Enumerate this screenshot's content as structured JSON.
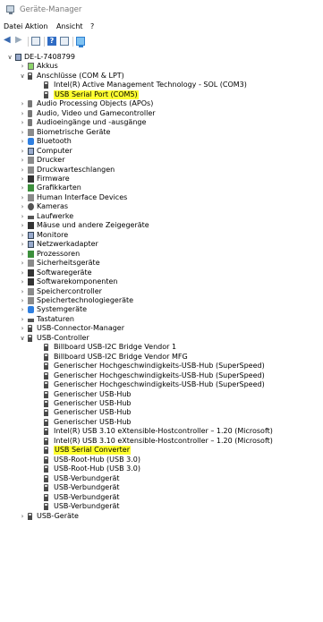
{
  "window": {
    "title": "Geräte-Manager"
  },
  "menu": [
    "Datei",
    "Aktion",
    "Ansicht",
    "?"
  ],
  "tree": [
    {
      "label": "DE-L-7408799",
      "level": 0,
      "exp": "v",
      "icon": "computer-icon",
      "cls": "i-pc"
    },
    {
      "label": "Akkus",
      "level": 1,
      "exp": ">",
      "icon": "battery-icon",
      "cls": "i-bat"
    },
    {
      "label": "Anschlüsse (COM & LPT)",
      "level": 1,
      "exp": "v",
      "icon": "port-icon",
      "cls": "i-usb"
    },
    {
      "label": "Intel(R) Active Management Technology - SOL (COM3)",
      "level": 2,
      "exp": "",
      "icon": "port-icon",
      "cls": "i-usb"
    },
    {
      "label": "USB Serial Port (COM5)",
      "level": 2,
      "exp": "",
      "icon": "port-icon",
      "cls": "i-usb",
      "hl": true
    },
    {
      "label": "Audio Processing Objects (APOs)",
      "level": 1,
      "exp": ">",
      "icon": "speaker-icon",
      "cls": "i-spk"
    },
    {
      "label": "Audio, Video und Gamecontroller",
      "level": 1,
      "exp": ">",
      "icon": "speaker-icon",
      "cls": "i-spk"
    },
    {
      "label": "Audioeingänge und -ausgänge",
      "level": 1,
      "exp": ">",
      "icon": "speaker-icon",
      "cls": "i-spk"
    },
    {
      "label": "Biometrische Geräte",
      "level": 1,
      "exp": ">",
      "icon": "biometric-icon",
      "cls": "i-gray"
    },
    {
      "label": "Bluetooth",
      "level": 1,
      "exp": ">",
      "icon": "bluetooth-icon",
      "cls": "i-blue"
    },
    {
      "label": "Computer",
      "level": 1,
      "exp": ">",
      "icon": "computer-icon",
      "cls": "i-pc"
    },
    {
      "label": "Drucker",
      "level": 1,
      "exp": ">",
      "icon": "printer-icon",
      "cls": "i-gray"
    },
    {
      "label": "Druckwarteschlangen",
      "level": 1,
      "exp": ">",
      "icon": "printer-queue-icon",
      "cls": "i-gray"
    },
    {
      "label": "Firmware",
      "level": 1,
      "exp": ">",
      "icon": "firmware-icon",
      "cls": "i-dark"
    },
    {
      "label": "Grafikkarten",
      "level": 1,
      "exp": ">",
      "icon": "display-adapter-icon",
      "cls": "i-green"
    },
    {
      "label": "Human Interface Devices",
      "level": 1,
      "exp": ">",
      "icon": "hid-icon",
      "cls": "i-gray"
    },
    {
      "label": "Kameras",
      "level": 1,
      "exp": ">",
      "icon": "camera-icon",
      "cls": "i-cam"
    },
    {
      "label": "Laufwerke",
      "level": 1,
      "exp": ">",
      "icon": "drive-icon",
      "cls": "i-flat"
    },
    {
      "label": "Mäuse und andere Zeigegeräte",
      "level": 1,
      "exp": ">",
      "icon": "mouse-icon",
      "cls": "i-dark"
    },
    {
      "label": "Monitore",
      "level": 1,
      "exp": ">",
      "icon": "monitor-icon",
      "cls": "i-pc"
    },
    {
      "label": "Netzwerkadapter",
      "level": 1,
      "exp": ">",
      "icon": "network-adapter-icon",
      "cls": "i-pc"
    },
    {
      "label": "Prozessoren",
      "level": 1,
      "exp": ">",
      "icon": "processor-icon",
      "cls": "i-green"
    },
    {
      "label": "Sicherheitsgeräte",
      "level": 1,
      "exp": ">",
      "icon": "security-device-icon",
      "cls": "i-gray"
    },
    {
      "label": "Softwaregeräte",
      "level": 1,
      "exp": ">",
      "icon": "software-device-icon",
      "cls": "i-dark"
    },
    {
      "label": "Softwarekomponenten",
      "level": 1,
      "exp": ">",
      "icon": "software-component-icon",
      "cls": "i-dark"
    },
    {
      "label": "Speichercontroller",
      "level": 1,
      "exp": ">",
      "icon": "storage-controller-icon",
      "cls": "i-gray"
    },
    {
      "label": "Speichertechnologiegeräte",
      "level": 1,
      "exp": ">",
      "icon": "storage-technology-icon",
      "cls": "i-gray"
    },
    {
      "label": "Systemgeräte",
      "level": 1,
      "exp": ">",
      "icon": "system-devices-icon",
      "cls": "i-blue"
    },
    {
      "label": "Tastaturen",
      "level": 1,
      "exp": ">",
      "icon": "keyboard-icon",
      "cls": "i-flat"
    },
    {
      "label": "USB-Connector-Manager",
      "level": 1,
      "exp": ">",
      "icon": "usb-icon",
      "cls": "i-usb"
    },
    {
      "label": "USB-Controller",
      "level": 1,
      "exp": "v",
      "icon": "usb-icon",
      "cls": "i-usb"
    },
    {
      "label": "Billboard USB-I2C Bridge Vendor 1",
      "level": 2,
      "exp": "",
      "icon": "usb-icon",
      "cls": "i-usb"
    },
    {
      "label": "Billboard USB-I2C Bridge Vendor MFG",
      "level": 2,
      "exp": "",
      "icon": "usb-icon",
      "cls": "i-usb"
    },
    {
      "label": "Generischer Hochgeschwindigkeits-USB-Hub (SuperSpeed)",
      "level": 2,
      "exp": "",
      "icon": "usb-icon",
      "cls": "i-usb"
    },
    {
      "label": "Generischer Hochgeschwindigkeits-USB-Hub (SuperSpeed)",
      "level": 2,
      "exp": "",
      "icon": "usb-icon",
      "cls": "i-usb"
    },
    {
      "label": "Generischer Hochgeschwindigkeits-USB-Hub (SuperSpeed)",
      "level": 2,
      "exp": "",
      "icon": "usb-icon",
      "cls": "i-usb"
    },
    {
      "label": "Generischer USB-Hub",
      "level": 2,
      "exp": "",
      "icon": "usb-icon",
      "cls": "i-usb"
    },
    {
      "label": "Generischer USB-Hub",
      "level": 2,
      "exp": "",
      "icon": "usb-icon",
      "cls": "i-usb"
    },
    {
      "label": "Generischer USB-Hub",
      "level": 2,
      "exp": "",
      "icon": "usb-icon",
      "cls": "i-usb"
    },
    {
      "label": "Generischer USB-Hub",
      "level": 2,
      "exp": "",
      "icon": "usb-icon",
      "cls": "i-usb"
    },
    {
      "label": "Intel(R) USB 3.10 eXtensible-Hostcontroller – 1.20 (Microsoft)",
      "level": 2,
      "exp": "",
      "icon": "usb-icon",
      "cls": "i-usb"
    },
    {
      "label": "Intel(R) USB 3.10 eXtensible-Hostcontroller – 1.20 (Microsoft)",
      "level": 2,
      "exp": "",
      "icon": "usb-icon",
      "cls": "i-usb"
    },
    {
      "label": "USB Serial Converter",
      "level": 2,
      "exp": "",
      "icon": "usb-icon",
      "cls": "i-usb",
      "hl": true
    },
    {
      "label": "USB-Root-Hub (USB 3.0)",
      "level": 2,
      "exp": "",
      "icon": "usb-icon",
      "cls": "i-usb"
    },
    {
      "label": "USB-Root-Hub (USB 3.0)",
      "level": 2,
      "exp": "",
      "icon": "usb-icon",
      "cls": "i-usb"
    },
    {
      "label": "USB-Verbundgerät",
      "level": 2,
      "exp": "",
      "icon": "usb-icon",
      "cls": "i-usb"
    },
    {
      "label": "USB-Verbundgerät",
      "level": 2,
      "exp": "",
      "icon": "usb-icon",
      "cls": "i-usb"
    },
    {
      "label": "USB-Verbundgerät",
      "level": 2,
      "exp": "",
      "icon": "usb-icon",
      "cls": "i-usb"
    },
    {
      "label": "USB-Verbundgerät",
      "level": 2,
      "exp": "",
      "icon": "usb-icon",
      "cls": "i-usb"
    },
    {
      "label": "USB-Geräte",
      "level": 1,
      "exp": ">",
      "icon": "usb-icon",
      "cls": "i-usb"
    }
  ],
  "colors": {
    "highlight": "#ffff30"
  }
}
